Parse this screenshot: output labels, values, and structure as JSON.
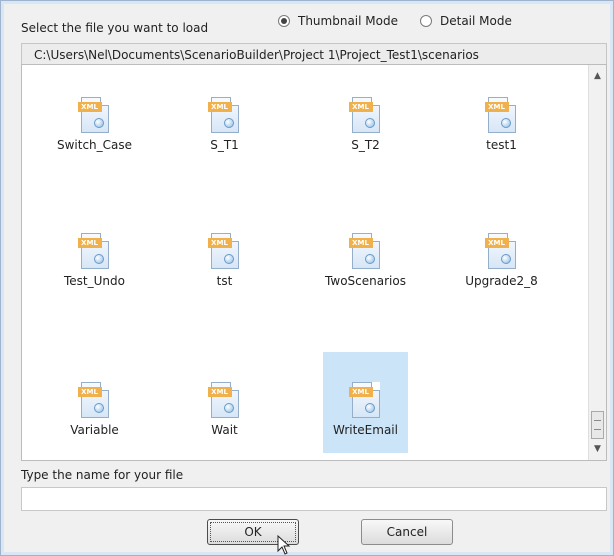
{
  "header": {
    "prompt": "Select the file you want to load",
    "modes": [
      {
        "label": "Thumbnail Mode",
        "checked": true
      },
      {
        "label": "Detail Mode",
        "checked": false
      }
    ]
  },
  "path": "C:\\Users\\Nel\\Documents\\ScenarioBuilder\\Project 1\\Project_Test1\\scenarios",
  "files": [
    {
      "name": "Switch_Case",
      "icon": "xml-file-icon",
      "selected": false
    },
    {
      "name": "S_T1",
      "icon": "xml-file-icon",
      "selected": false
    },
    {
      "name": "S_T2",
      "icon": "xml-file-icon",
      "selected": false
    },
    {
      "name": "test1",
      "icon": "xml-file-icon",
      "selected": false
    },
    {
      "name": "Test_Undo",
      "icon": "xml-file-icon",
      "selected": false
    },
    {
      "name": "tst",
      "icon": "xml-file-icon",
      "selected": false
    },
    {
      "name": "TwoScenarios",
      "icon": "xml-file-icon",
      "selected": false
    },
    {
      "name": "Upgrade2_8",
      "icon": "xml-file-icon",
      "selected": false
    },
    {
      "name": "Variable",
      "icon": "xml-file-icon",
      "selected": false
    },
    {
      "name": "Wait",
      "icon": "xml-file-icon",
      "selected": false
    },
    {
      "name": "WriteEmail",
      "icon": "xml-file-icon",
      "selected": true
    }
  ],
  "icon_tag": "XML",
  "filename": {
    "label": "Type the name for your file",
    "value": ""
  },
  "buttons": {
    "ok": "OK",
    "cancel": "Cancel"
  },
  "colors": {
    "selection": "#cce4f7",
    "xml_tag": "#f0b14c"
  }
}
